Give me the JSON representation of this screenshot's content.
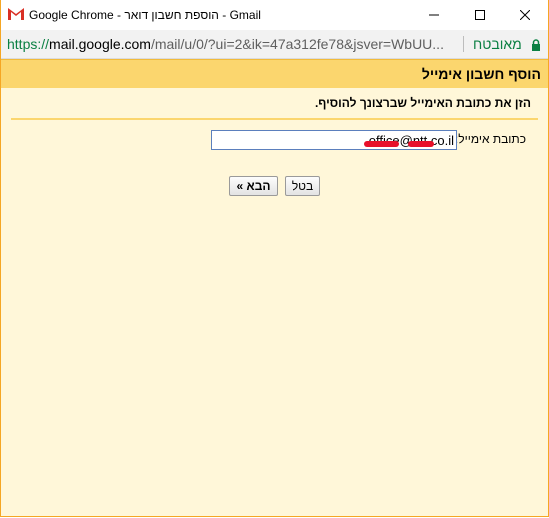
{
  "window": {
    "title": "Google Chrome - הוספת חשבון דואר - Gmail",
    "minimize_glyph": "—",
    "maximize_glyph": "☐",
    "close_glyph": "✕"
  },
  "addressbar": {
    "url_scheme": "https://",
    "url_domain": "mail.google.com",
    "url_path": "/mail/u/0/?ui=2&ik=47a312fe78&jsver=WbUU...",
    "secure_label": "מאובטח",
    "secure_color": "#0b8043"
  },
  "dialog": {
    "header_title": "הוסף חשבון אימייל",
    "instruction": "הזן את כתובת האימייל שברצונך להוסיף.",
    "email_label": "כתובת אימייל:",
    "email_value": "office@ntt.co.il",
    "cancel_label": "בטל",
    "next_label": "הבא »"
  },
  "colors": {
    "header_band": "#fbd66e",
    "content_bg": "#fff7d9",
    "window_border": "#f5a623",
    "redaction": "#e8102a"
  }
}
